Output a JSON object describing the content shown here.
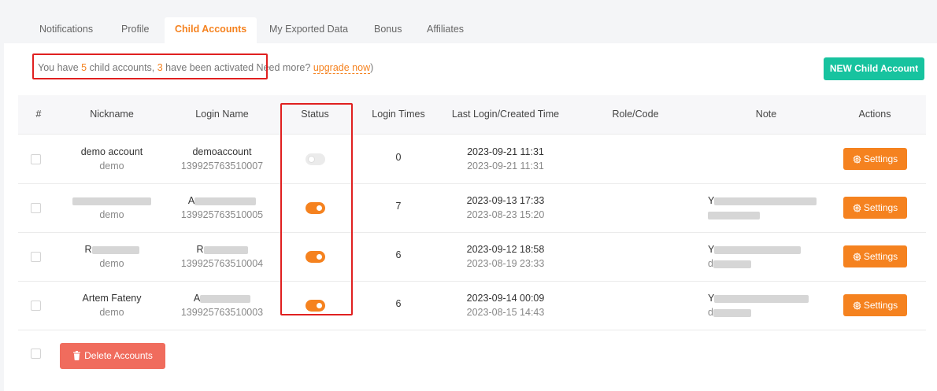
{
  "tabs": [
    {
      "label": "Notifications",
      "active": false
    },
    {
      "label": "Profile",
      "active": false
    },
    {
      "label": "Child Accounts",
      "active": true
    },
    {
      "label": "My Exported Data",
      "active": false
    },
    {
      "label": "Bonus",
      "active": false
    },
    {
      "label": "Affiliates",
      "active": false
    }
  ],
  "summary": {
    "prefix": "You have ",
    "child_count": "5",
    "mid": " child accounts,  ",
    "activated_count": "3",
    "suffix": " have been activated",
    "need_more": " Need more? ",
    "upgrade_link": "upgrade now",
    "close_paren": ")"
  },
  "new_account_button": "NEW Child Account",
  "table": {
    "columns": [
      "#",
      "Nickname",
      "Login Name",
      "Status",
      "Login Times",
      "Last Login/Created Time",
      "Role/Code",
      "Note",
      "Actions"
    ],
    "rows": [
      {
        "nickname": "demo account",
        "nickname_sub": "demo",
        "login_name": "demoaccount",
        "login_id": "139925763510007",
        "status": "inactive",
        "login_times": "0",
        "last_login": "2023-09-21 11:31",
        "created": "2023-09-21 11:31",
        "role": "",
        "note1": "",
        "note2": "",
        "action": "Settings"
      },
      {
        "nickname": "",
        "nickname_sub": "demo",
        "login_name": "A",
        "login_id": "139925763510005",
        "status": "active",
        "login_times": "7",
        "last_login": "2023-09-13 17:33",
        "created": "2023-08-23 15:20",
        "role": "",
        "note1": "Y",
        "note2": "",
        "action": "Settings"
      },
      {
        "nickname": "R",
        "nickname_sub": "demo",
        "login_name": "R",
        "login_id": "139925763510004",
        "status": "active",
        "login_times": "6",
        "last_login": "2023-09-12 18:58",
        "created": "2023-08-19 23:33",
        "role": "",
        "note1": "Y",
        "note2": "d",
        "action": "Settings"
      },
      {
        "nickname": "Artem Fateny",
        "nickname_sub": "demo",
        "login_name": "A",
        "login_id": "139925763510003",
        "status": "active",
        "login_times": "6",
        "last_login": "2023-09-14 00:09",
        "created": "2023-08-15 14:43",
        "role": "",
        "note1": "Y",
        "note2": "d",
        "action": "Settings"
      }
    ]
  },
  "delete_button": "Delete Accounts",
  "colors": {
    "accent": "#f5821f",
    "primary_green": "#17c39f",
    "danger": "#f06c5d",
    "highlight_box": "#e02020"
  },
  "icons": {
    "settings": "gear-icon",
    "delete": "trash-icon"
  }
}
